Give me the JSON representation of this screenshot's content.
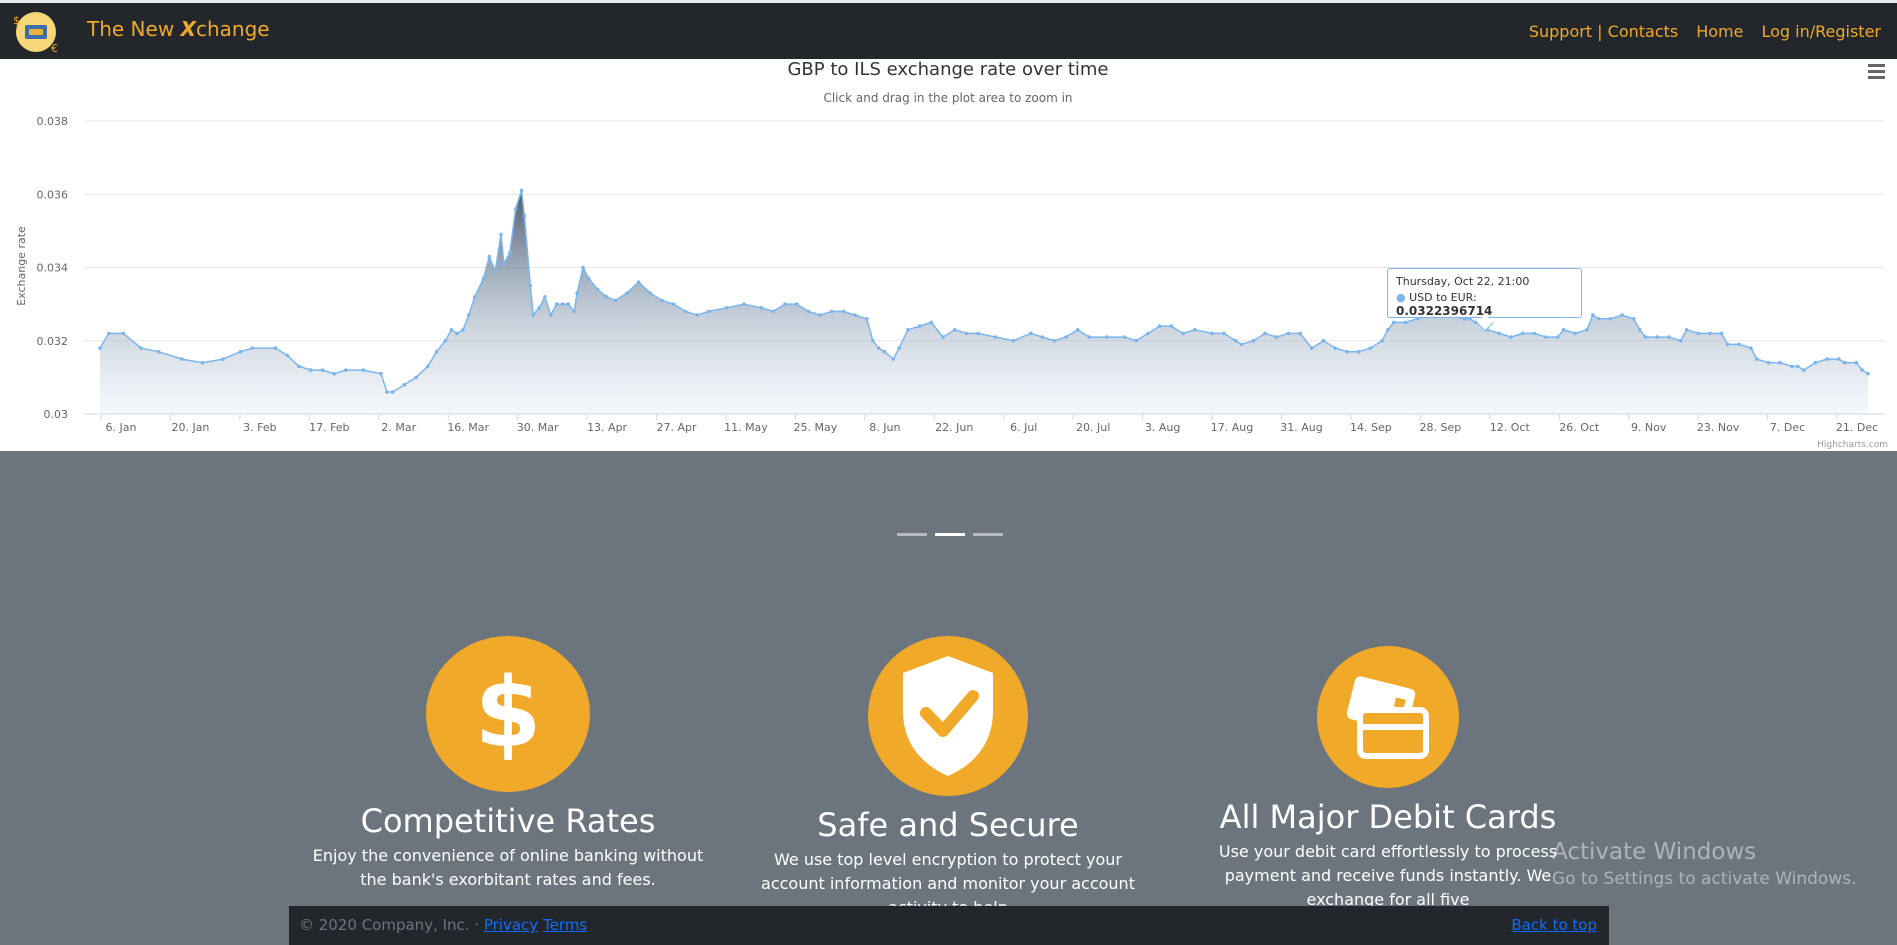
{
  "brand": {
    "prefix": "The New ",
    "x": "X",
    "suffix": "change"
  },
  "nav": {
    "support": "Support | Contacts",
    "home": "Home",
    "login": "Log in/Register"
  },
  "menu_icon": "hamburger-menu-icon",
  "tooltip": {
    "date": "Thursday, Oct 22, 21:00",
    "series": "USD to EUR:",
    "value": "0.0322396714"
  },
  "chart_data": {
    "type": "area",
    "title": "GBP to ILS exchange rate over time",
    "subtitle": "Click and drag in the plot area to zoom in",
    "ylabel": "Exchange rate",
    "ylim": [
      0.03,
      0.038
    ],
    "yticks": [
      "0.03",
      "0.032",
      "0.034",
      "0.036",
      "0.038"
    ],
    "xticks": [
      "6. Jan",
      "20. Jan",
      "3. Feb",
      "17. Feb",
      "2. Mar",
      "16. Mar",
      "30. Mar",
      "13. Apr",
      "27. Apr",
      "11. May",
      "25. May",
      "8. Jun",
      "22. Jun",
      "6. Jul",
      "20. Jul",
      "3. Aug",
      "17. Aug",
      "31. Aug",
      "14. Sep",
      "28. Sep",
      "12. Oct",
      "26. Oct",
      "9. Nov",
      "23. Nov",
      "7. Dec",
      "21. Dec"
    ],
    "credits": "Highcharts.com",
    "color": "#7cb5ec",
    "series": [
      {
        "name": "USD to EUR",
        "points": [
          [
            0,
            0.0318
          ],
          [
            3,
            0.0322
          ],
          [
            8,
            0.0322
          ],
          [
            14,
            0.0318
          ],
          [
            20,
            0.0317
          ],
          [
            28,
            0.0315
          ],
          [
            35,
            0.0314
          ],
          [
            42,
            0.0315
          ],
          [
            48,
            0.0317
          ],
          [
            52,
            0.0318
          ],
          [
            60,
            0.0318
          ],
          [
            64,
            0.0316
          ],
          [
            68,
            0.0313
          ],
          [
            72,
            0.0312
          ],
          [
            76,
            0.0312
          ],
          [
            80,
            0.0311
          ],
          [
            84,
            0.0312
          ],
          [
            90,
            0.0312
          ],
          [
            96,
            0.0311
          ],
          [
            98,
            0.0306
          ],
          [
            100,
            0.0306
          ],
          [
            104,
            0.0308
          ],
          [
            108,
            0.031
          ],
          [
            112,
            0.0313
          ],
          [
            115,
            0.0317
          ],
          [
            118,
            0.032
          ],
          [
            120,
            0.0323
          ],
          [
            122,
            0.0322
          ],
          [
            124,
            0.0323
          ],
          [
            126,
            0.0327
          ],
          [
            128,
            0.0332
          ],
          [
            131,
            0.0337
          ],
          [
            133,
            0.0343
          ],
          [
            135,
            0.0339
          ],
          [
            137,
            0.0349
          ],
          [
            138,
            0.0341
          ],
          [
            140,
            0.0344
          ],
          [
            142,
            0.0356
          ],
          [
            144,
            0.0361
          ],
          [
            145,
            0.0354
          ],
          [
            147,
            0.0335
          ],
          [
            148,
            0.0327
          ],
          [
            150,
            0.0329
          ],
          [
            152,
            0.0332
          ],
          [
            154,
            0.0327
          ],
          [
            156,
            0.033
          ],
          [
            158,
            0.033
          ],
          [
            160,
            0.033
          ],
          [
            162,
            0.0328
          ],
          [
            163,
            0.0333
          ],
          [
            165,
            0.034
          ],
          [
            167,
            0.0337
          ],
          [
            170,
            0.0334
          ],
          [
            173,
            0.0332
          ],
          [
            176,
            0.0331
          ],
          [
            180,
            0.0333
          ],
          [
            184,
            0.0336
          ],
          [
            188,
            0.0333
          ],
          [
            192,
            0.0331
          ],
          [
            196,
            0.033
          ],
          [
            200,
            0.0328
          ],
          [
            204,
            0.0327
          ],
          [
            208,
            0.0328
          ],
          [
            214,
            0.0329
          ],
          [
            220,
            0.033
          ],
          [
            226,
            0.0329
          ],
          [
            230,
            0.0328
          ],
          [
            234,
            0.033
          ],
          [
            238,
            0.033
          ],
          [
            242,
            0.0328
          ],
          [
            246,
            0.0327
          ],
          [
            250,
            0.0328
          ],
          [
            254,
            0.0328
          ],
          [
            258,
            0.0327
          ],
          [
            262,
            0.0326
          ],
          [
            264,
            0.032
          ],
          [
            266,
            0.0318
          ],
          [
            268,
            0.0317
          ],
          [
            271,
            0.0315
          ],
          [
            273,
            0.0318
          ],
          [
            276,
            0.0323
          ],
          [
            280,
            0.0324
          ],
          [
            284,
            0.0325
          ],
          [
            288,
            0.0321
          ],
          [
            292,
            0.0323
          ],
          [
            296,
            0.0322
          ],
          [
            300,
            0.0322
          ],
          [
            306,
            0.0321
          ],
          [
            312,
            0.032
          ],
          [
            318,
            0.0322
          ],
          [
            322,
            0.0321
          ],
          [
            326,
            0.032
          ],
          [
            330,
            0.0321
          ],
          [
            334,
            0.0323
          ],
          [
            338,
            0.0321
          ],
          [
            344,
            0.0321
          ],
          [
            350,
            0.0321
          ],
          [
            354,
            0.032
          ],
          [
            358,
            0.0322
          ],
          [
            362,
            0.0324
          ],
          [
            366,
            0.0324
          ],
          [
            370,
            0.0322
          ],
          [
            374,
            0.0323
          ],
          [
            380,
            0.0322
          ],
          [
            384,
            0.0322
          ],
          [
            388,
            0.032
          ],
          [
            390,
            0.0319
          ],
          [
            394,
            0.032
          ],
          [
            398,
            0.0322
          ],
          [
            402,
            0.0321
          ],
          [
            406,
            0.0322
          ],
          [
            410,
            0.0322
          ],
          [
            414,
            0.0318
          ],
          [
            418,
            0.032
          ],
          [
            422,
            0.0318
          ],
          [
            426,
            0.0317
          ],
          [
            430,
            0.0317
          ],
          [
            434,
            0.0318
          ],
          [
            438,
            0.032
          ],
          [
            440,
            0.0323
          ],
          [
            442,
            0.0325
          ],
          [
            446,
            0.0325
          ],
          [
            450,
            0.0326
          ],
          [
            454,
            0.0327
          ],
          [
            458,
            0.0328
          ],
          [
            462,
            0.0327
          ],
          [
            466,
            0.0326
          ],
          [
            468,
            0.0326
          ],
          [
            470,
            0.0325
          ],
          [
            474,
            0.0323
          ],
          [
            478,
            0.0322
          ],
          [
            482,
            0.0321
          ],
          [
            486,
            0.0322
          ],
          [
            490,
            0.0322
          ],
          [
            494,
            0.0321
          ],
          [
            498,
            0.0321
          ],
          [
            500,
            0.0323
          ],
          [
            504,
            0.0322
          ],
          [
            508,
            0.0323
          ],
          [
            510,
            0.0327
          ],
          [
            512,
            0.0326
          ],
          [
            516,
            0.0326
          ],
          [
            520,
            0.0327
          ],
          [
            524,
            0.0326
          ],
          [
            526,
            0.0323
          ],
          [
            528,
            0.0321
          ],
          [
            532,
            0.0321
          ],
          [
            536,
            0.0321
          ],
          [
            540,
            0.032
          ],
          [
            542,
            0.0323
          ],
          [
            546,
            0.0322
          ],
          [
            550,
            0.0322
          ],
          [
            554,
            0.0322
          ],
          [
            556,
            0.0319
          ],
          [
            560,
            0.0319
          ],
          [
            564,
            0.0318
          ],
          [
            566,
            0.0315
          ],
          [
            570,
            0.0314
          ],
          [
            574,
            0.0314
          ],
          [
            578,
            0.0313
          ],
          [
            580,
            0.0313
          ],
          [
            582,
            0.0312
          ],
          [
            586,
            0.0314
          ],
          [
            590,
            0.0315
          ],
          [
            594,
            0.0315
          ],
          [
            596,
            0.0314
          ],
          [
            600,
            0.0314
          ],
          [
            602,
            0.0312
          ],
          [
            604,
            0.0311
          ]
        ]
      }
    ]
  },
  "carousel": {
    "indicators": 3,
    "active": 1
  },
  "features": [
    {
      "icon": "dollar-icon",
      "title": "Competitive Rates",
      "text": "Enjoy the convenience of online banking without the bank's exorbitant rates and fees."
    },
    {
      "icon": "shield-check-icon",
      "title": "Safe and Secure",
      "text": "We use top level encryption to protect your account information and monitor your account activity to help"
    },
    {
      "icon": "credit-card-icon",
      "title": "All Major Debit Cards",
      "text": "Use your debit card effortlessly to process payment and receive funds instantly. We exchange for all five"
    }
  ],
  "watermark": {
    "line1": "Activate Windows",
    "line2": "Go to Settings to activate Windows."
  },
  "footer": {
    "copyright": "© 2020 Company, Inc. · ",
    "privacy": "Privacy",
    "terms": "Terms",
    "back_to_top": "Back to top"
  }
}
